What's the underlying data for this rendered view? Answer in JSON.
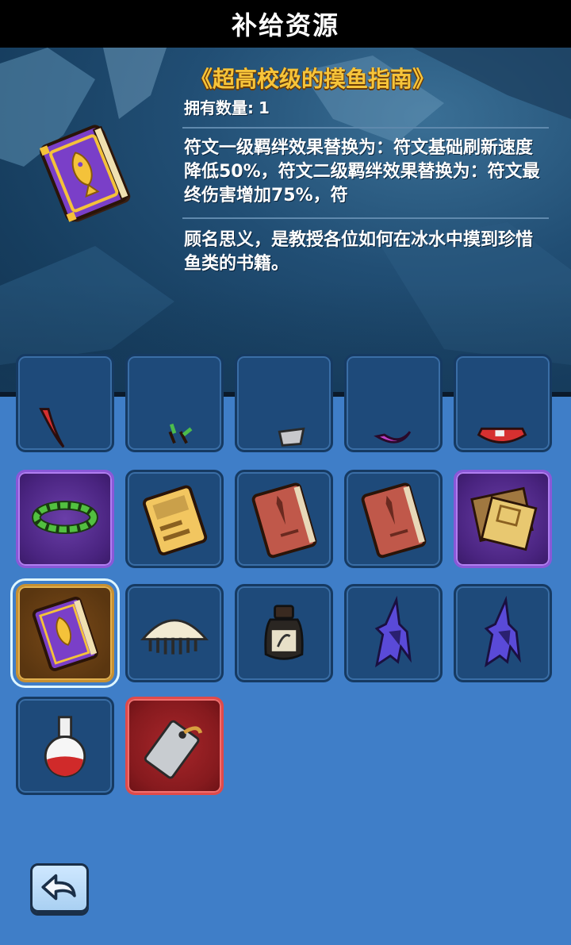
{
  "header": {
    "title": "补给资源"
  },
  "detail": {
    "item_name": "《超高校级的摸鱼指南》",
    "owned_label": "拥有数量:",
    "owned_count": "1",
    "effect_text": "符文一级羁绊效果替换为：符文基础刷新速度降低50%，符文二级羁绊效果替换为：符文最终伤害增加75%，符",
    "flavor_text": "顾名思义，是教授各位如何在冰水中摸到珍惜鱼类的书籍。",
    "icon": "fish-book-icon"
  },
  "inventory": {
    "rows": [
      [
        "red-feather-icon",
        "green-sprout-icon",
        "silver-tool-icon",
        "pink-horn-icon",
        "red-gem-icon"
      ],
      [
        "laurel-wreath-icon",
        "yellow-book-icon",
        "brown-book-icon",
        "brown-book-icon",
        "map-scroll-icon"
      ],
      [
        "fish-book-icon",
        "comb-icon",
        "ink-bottle-icon",
        "wizard-hat-icon",
        "wizard-hat-icon"
      ],
      [
        "potion-flask-icon",
        "tag-icon"
      ]
    ],
    "selected": "fish-book-icon"
  },
  "controls": {
    "back_icon": "back-arrow-icon"
  },
  "colors": {
    "accent": "#f6c43a",
    "panel": "#3f7ec8",
    "slot": "#1e4a7a"
  }
}
